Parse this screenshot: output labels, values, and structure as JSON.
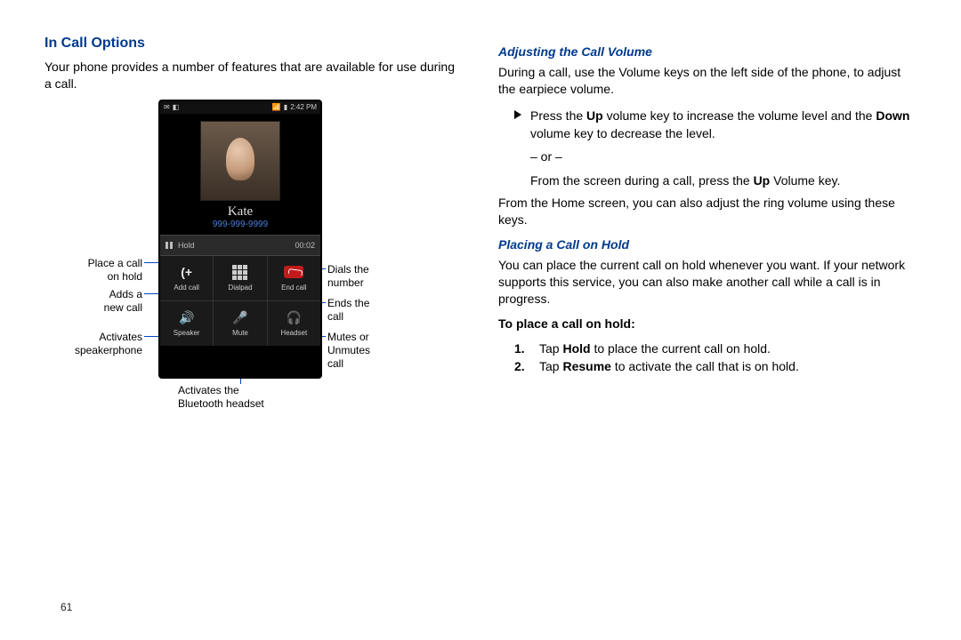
{
  "pageNumber": "61",
  "left": {
    "heading": "In Call Options",
    "intro": "Your phone provides a number of features that are available for use during a call.",
    "callouts": {
      "hold": "Place a call on hold",
      "addcall": "Adds a new call",
      "speaker": "Activates speakerphone",
      "headset": "Activates the Bluetooth headset",
      "dialpad": "Dials the number",
      "endcall": "Ends the call",
      "mute": "Mutes or Unmutes call"
    },
    "phone": {
      "status_time": "2:42 PM",
      "contact_name": "Kate",
      "contact_number": "999-999-9999",
      "hold_label": "Hold",
      "timer": "00:02",
      "buttons": {
        "addcall": "Add call",
        "dialpad": "Dialpad",
        "endcall": "End call",
        "speaker": "Speaker",
        "mute": "Mute",
        "headset": "Headset"
      }
    }
  },
  "right": {
    "vol_heading": "Adjusting the Call Volume",
    "vol_intro": "During a call, use the Volume keys on the left side of the phone, to adjust the earpiece volume.",
    "vol_bullet_pre": "Press the ",
    "vol_bullet_up": "Up",
    "vol_bullet_mid": " volume key to increase the volume level and the ",
    "vol_bullet_down": "Down",
    "vol_bullet_post": " volume key to decrease the level.",
    "or": "– or –",
    "vol_alt_pre": "From the screen during a call, press the ",
    "vol_alt_up": "Up",
    "vol_alt_post": " Volume key.",
    "vol_home": "From the Home screen, you can also adjust the ring volume using these keys.",
    "hold_heading": "Placing a Call on Hold",
    "hold_intro": "You can place the current call on hold whenever you want. If your network supports this service, you can also make another call while a call is in progress.",
    "hold_steps_heading": "To place a call on hold:",
    "step1_pre": "Tap ",
    "step1_b": "Hold",
    "step1_post": " to place the current call on hold.",
    "step2_pre": "Tap ",
    "step2_b": "Resume",
    "step2_post": " to activate the call that is on hold."
  }
}
